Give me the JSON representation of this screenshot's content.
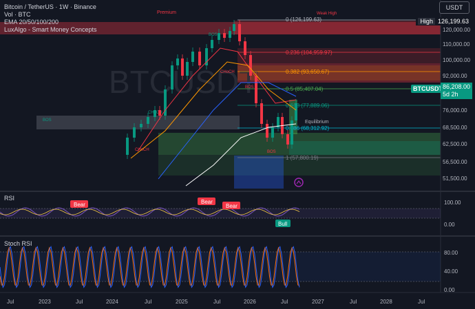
{
  "header": {
    "symbol_line": "Bitcoin / TetherUS · 1W · Binance",
    "indicators": [
      "Vol · BTC",
      "EMA 20/50/100/200",
      "LuxAlgo - Smart Money Concepts"
    ],
    "watermark": "BTCUSDT",
    "currency_button": "USDT"
  },
  "price_axis": {
    "labels": [
      "120,000.00",
      "110,000.00",
      "100,000.00",
      "92,000.00",
      "76,000.00",
      "68,500.00",
      "62,500.00",
      "56,500.00",
      "51,500.00"
    ],
    "high_label": "High",
    "high_value": "126,199.63",
    "symbol_tag": "BTCUSDT",
    "last_price": "86,208.00",
    "countdown": "5d 2h"
  },
  "time_axis": {
    "labels": [
      "Jul",
      "2023",
      "Jul",
      "2024",
      "Jul",
      "2025",
      "Jul",
      "2026",
      "Jul",
      "2027",
      "Jul",
      "2028",
      "Jul"
    ]
  },
  "annotations": {
    "premium": "Premium",
    "weak_high": "Weak High",
    "equilibrium": "Equilibrium",
    "bos": "BOS",
    "choch": "CHoCH"
  },
  "fibonacci": [
    {
      "label": "0 (126,199.63)",
      "color": "#b2b5be"
    },
    {
      "label": "0.236 (104,959.97)",
      "color": "#f23645"
    },
    {
      "label": "0.382 (93,650.67)",
      "color": "#ff9800"
    },
    {
      "label": "0.5 (85,407.04)",
      "color": "#4caf50"
    },
    {
      "label": "0.618 (77,889.06)",
      "color": "#089981"
    },
    {
      "label": "0.786 (68,312.92)",
      "color": "#00bcd4"
    },
    {
      "label": "1 (57,800.19)",
      "color": "#787b86"
    }
  ],
  "rsi": {
    "title": "RSI",
    "axis": [
      "100.00",
      "0.00"
    ],
    "signals": [
      "Bear",
      "Bear",
      "Bear",
      "Bull"
    ]
  },
  "stoch_rsi": {
    "title": "Stoch RSI",
    "axis": [
      "80.00",
      "40.00",
      "0.00"
    ]
  },
  "colors": {
    "background": "#131722",
    "up": "#089981",
    "down": "#f23645",
    "rsi_line": "#7e57c2",
    "stoch_k": "#2962ff",
    "stoch_d": "#ff6d00"
  }
}
